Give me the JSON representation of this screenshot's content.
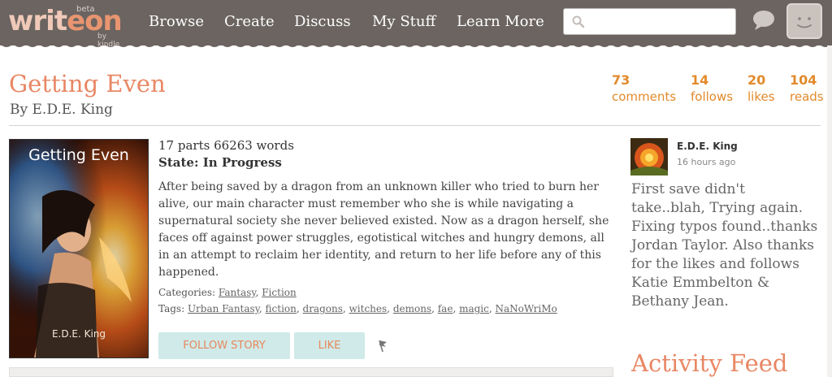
{
  "header": {
    "logo_part1": "writ",
    "logo_part2": "eon",
    "logo_beta": "beta",
    "logo_sub": "by kindle",
    "nav": [
      "Browse",
      "Create",
      "Discuss",
      "My Stuff",
      "Learn More"
    ],
    "search_value": "",
    "search_placeholder": ""
  },
  "story": {
    "title": "Getting Even",
    "byline": "By E.D.E. King",
    "stats": [
      {
        "value": "73",
        "label": "comments"
      },
      {
        "value": "14",
        "label": "follows"
      },
      {
        "value": "20",
        "label": "likes"
      },
      {
        "value": "104",
        "label": "reads"
      }
    ],
    "cover_title": "Getting Even",
    "cover_author": "E.D.E. King",
    "parts_words": "17 parts 66263 words",
    "state": "State: In Progress",
    "description": "After being saved by a dragon from an unknown killer who tried to burn her alive, our main character must remember who she is while navigating a supernatural society she never believed existed. Now as a dragon herself, she faces off against power struggles, egotistical witches and hungry demons, all in an attempt to reclaim her identity, and return to her life before any of this happened.",
    "categories_label": "Categories:",
    "categories": [
      "Fantasy",
      "Fiction"
    ],
    "tags_label": "Tags:",
    "tags": [
      "Urban Fantasy",
      "fiction",
      "dragons",
      "witches",
      "demons",
      "fae",
      "magic",
      "NaNoWriMo"
    ],
    "follow_label": "FOLLOW STORY",
    "like_label": "LIKE"
  },
  "sidebar": {
    "author_name": "E.D.E. King",
    "time": "16 hours ago",
    "status": "First save didn't take..blah, Trying again. Fixing typos found..thanks Jordan Taylor. Also thanks for the likes and follows Katie Emmbelton & Bethany Jean.",
    "feed_title": "Activity Feed"
  },
  "colors": {
    "header_bg": "#6b6461",
    "accent": "#e88764",
    "stat_color": "#e28a2c",
    "button_bg": "#cfeae8"
  }
}
